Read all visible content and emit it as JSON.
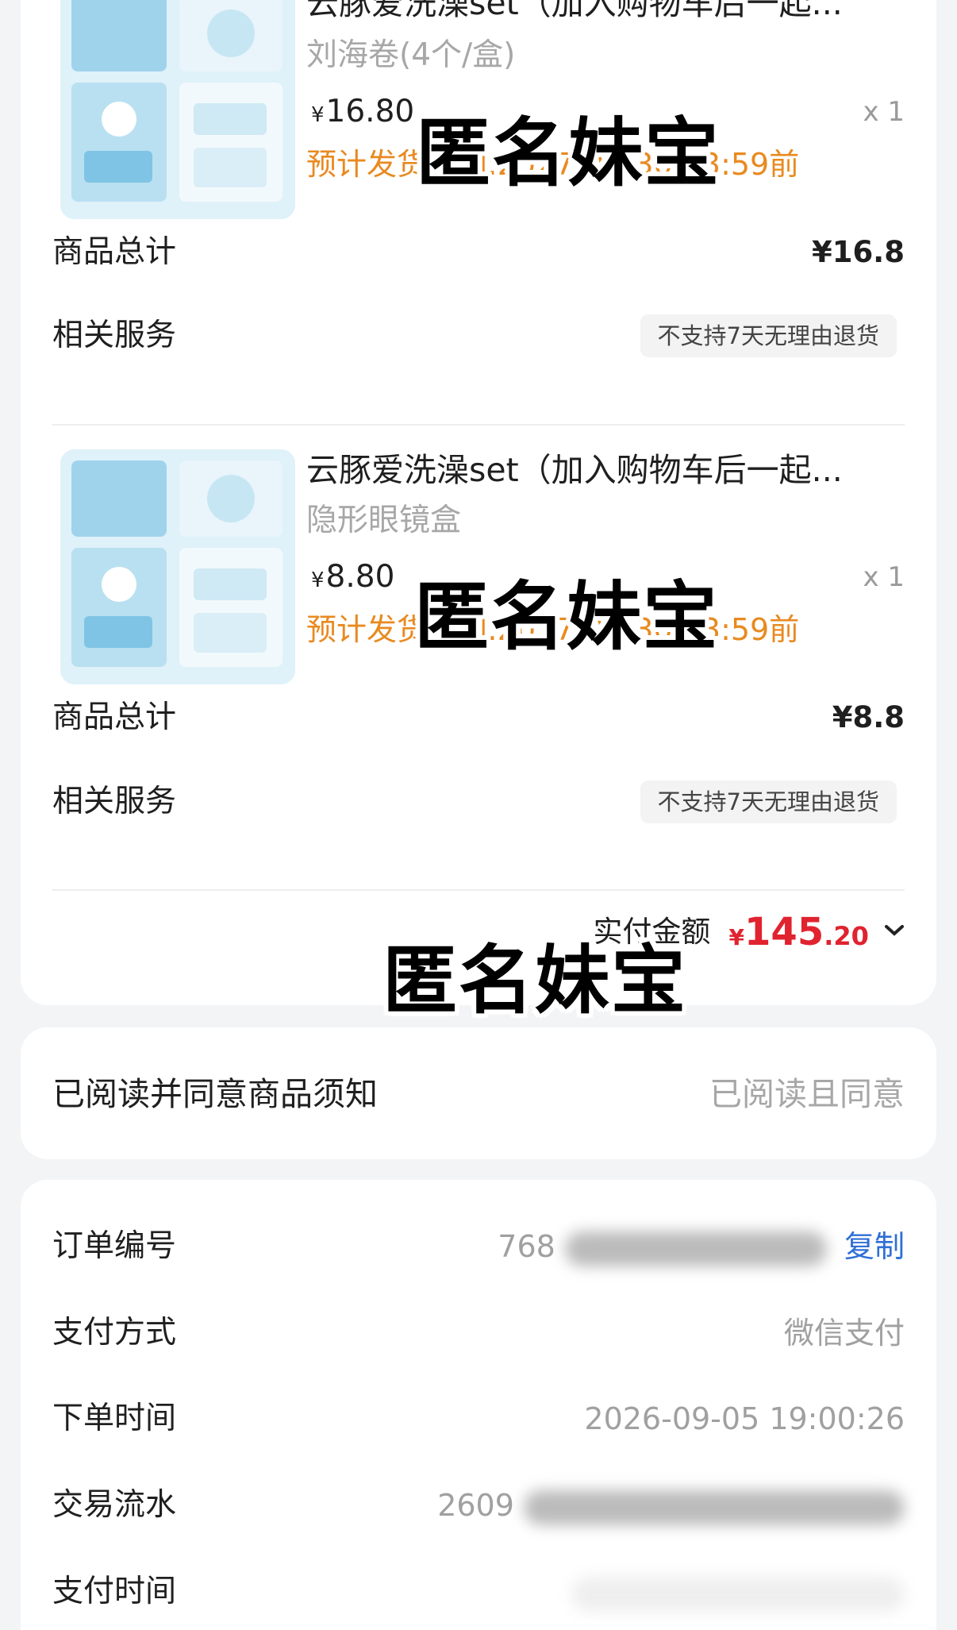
{
  "products": [
    {
      "title": "云豚爱洗澡set（加入购物车后一起...",
      "variant": "刘海卷(4个/盒)",
      "currency": "¥",
      "price": "16.80",
      "quantity": "x 1",
      "ship_time": "预计发货时间:2027-01-30 23:59前",
      "subtotal_label": "商品总计",
      "subtotal_value": "¥16.8",
      "service_label": "相关服务",
      "service_value": "不支持7天无理由退货"
    },
    {
      "title": "云豚爱洗澡set（加入购物车后一起...",
      "variant": "隐形眼镜盒",
      "currency": "¥",
      "price": "8.80",
      "quantity": "x 1",
      "ship_time": "预计发货时间:2027-01-30 23:59前",
      "subtotal_label": "商品总计",
      "subtotal_value": "¥8.8",
      "service_label": "相关服务",
      "service_value": "不支持7天无理由退货"
    }
  ],
  "payment_total": {
    "label": "实付金额",
    "currency": "¥",
    "integer": "145",
    "decimal": ".20"
  },
  "notice": {
    "label": "已阅读并同意商品须知",
    "value": "已阅读且同意"
  },
  "order_info": {
    "order_no_label": "订单编号",
    "order_no_visible": "768",
    "copy_label": "复制",
    "pay_method_label": "支付方式",
    "pay_method_value": "微信支付",
    "order_time_label": "下单时间",
    "order_time_value": "2026-09-05 19:00:26",
    "txn_label": "交易流水",
    "txn_visible": "2609",
    "pay_time_label": "支付时间"
  },
  "watermark_text": "匿名妹宝",
  "colors": {
    "price_red": "#e0232f",
    "ship_orange": "#e88a20",
    "link_blue": "#2f6fd6",
    "muted_gray": "#a7a7a7",
    "page_bg": "#f3f4f6"
  }
}
